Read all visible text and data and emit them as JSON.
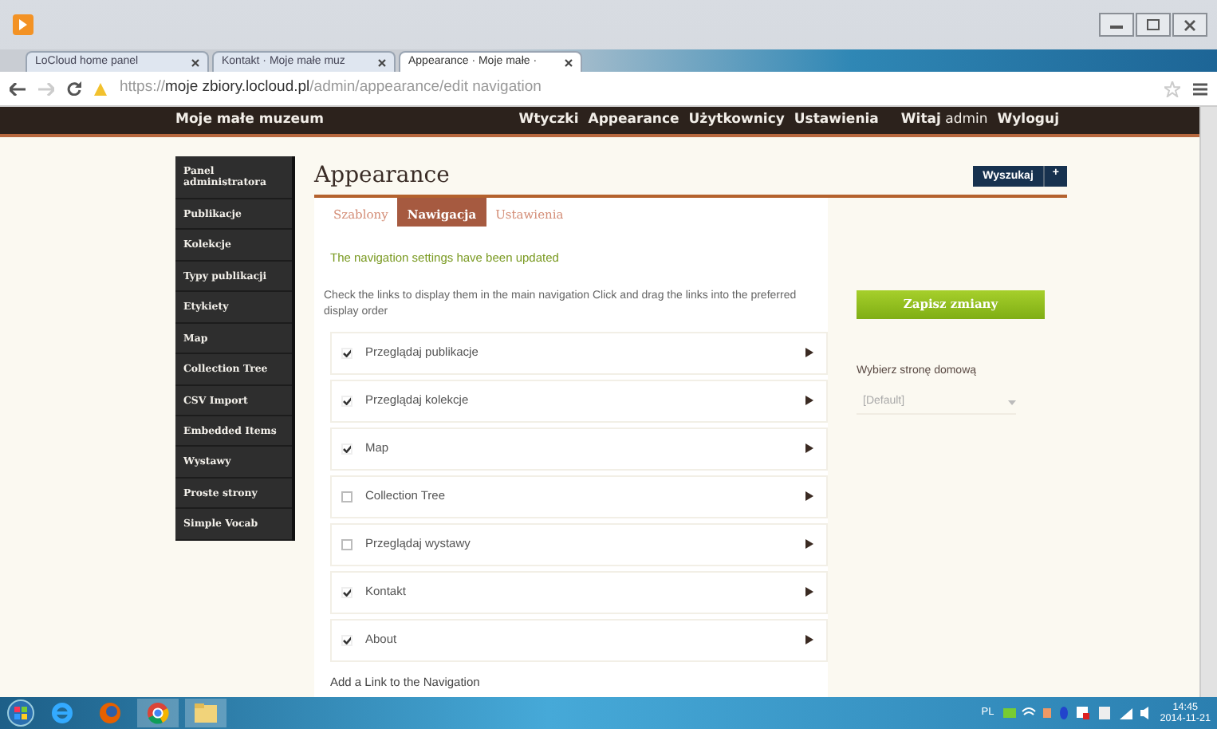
{
  "browser": {
    "tabs": [
      {
        "title": "LoCloud home panel",
        "selected": false
      },
      {
        "title": "Kontakt · Moje małe muz",
        "selected": false
      },
      {
        "title": "Appearance · Moje małe ·",
        "selected": true
      }
    ],
    "url_host": "moje zbiory.locloud.pl",
    "url_scheme": "https://",
    "url_path": "/admin/appearance/edit navigation"
  },
  "site": {
    "brand": "Moje małe muzeum",
    "links": [
      "Wtyczki",
      "Appearance",
      "Użytkownicy",
      "Ustawienia"
    ],
    "greeting": "**Witaj** admin",
    "logout": "Wyloguj"
  },
  "sidebar": {
    "items": [
      "Panel administratora",
      "Publikacje",
      "Kolekcje",
      "Typy publikacji",
      "Etykiety",
      "Map",
      "Collection Tree",
      "CSV Import",
      "Embedded Items",
      "Wystawy",
      "Proste strony",
      "Simple Vocab"
    ]
  },
  "main": {
    "title": "Appearance",
    "search_button": "Wyszukaj",
    "add_button": "+",
    "subtabs": [
      {
        "label": "Szablony",
        "selected": false
      },
      {
        "label": "Nawigacja",
        "selected": true
      },
      {
        "label": "Ustawienia",
        "selected": false
      }
    ],
    "message": "The navigation settings have been updated",
    "instructions": "Check the links to display them in the main navigation  Click and drag the links into the preferred display order",
    "nav_items": [
      {
        "label": "Przeglądaj publikacje",
        "checked": true
      },
      {
        "label": "Przeglądaj kolekcje",
        "checked": true
      },
      {
        "label": "Map",
        "checked": true
      },
      {
        "label": "Collection Tree",
        "checked": false
      },
      {
        "label": "Przeglądaj wystawy",
        "checked": false
      },
      {
        "label": "Kontakt",
        "checked": true
      },
      {
        "label": "About",
        "checked": true
      }
    ],
    "add_link": "Add a Link to the Navigation",
    "save_button": "Zapisz zmiany",
    "homepage_label": "Wybierz stronę domową",
    "homepage_value": "[Default]"
  },
  "taskbar": {
    "language": "PL",
    "time": "14:45",
    "date": "2014-11-21"
  }
}
